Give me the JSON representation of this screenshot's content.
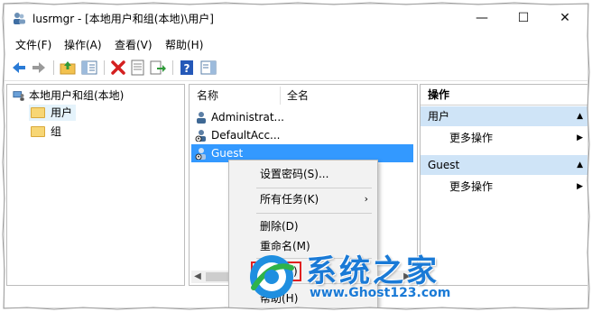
{
  "window": {
    "title": "lusrmgr - [本地用户和组(本地)\\用户]",
    "minimize_glyph": "—",
    "maximize_glyph": "☐",
    "close_glyph": "✕"
  },
  "menubar": {
    "items": [
      "文件(F)",
      "操作(A)",
      "查看(V)",
      "帮助(H)"
    ]
  },
  "toolbar": {
    "icons": [
      "back-icon",
      "forward-icon",
      "up-folder-icon",
      "show-tree-icon",
      "delete-icon",
      "properties-icon",
      "export-icon",
      "help-icon",
      "show-action-pane-icon"
    ]
  },
  "tree": {
    "root": "本地用户和组(本地)",
    "children": [
      "用户",
      "组"
    ],
    "selected": "用户"
  },
  "list": {
    "columns": [
      "名称",
      "全名"
    ],
    "rows": [
      "Administrat...",
      "DefaultAcc...",
      "Guest"
    ],
    "selected": "Guest"
  },
  "actions": {
    "header": "操作",
    "groups": [
      {
        "title": "用户",
        "item": "更多操作"
      },
      {
        "title": "Guest",
        "item": "更多操作"
      }
    ]
  },
  "context_menu": {
    "items": [
      "设置密码(S)...",
      "所有任务(K)",
      "删除(D)",
      "重命名(M)",
      "属性(R)",
      "帮助(H)"
    ],
    "submenu_glyph": "›",
    "highlighted": "属性(R)"
  },
  "watermark": {
    "title": "系统之家",
    "url": "www.Ghost123.com"
  },
  "colors": {
    "selection": "#3399ff",
    "action_group": "#cfe4f7",
    "highlight_box": "#e02020",
    "watermark": "#1a7ad6"
  }
}
